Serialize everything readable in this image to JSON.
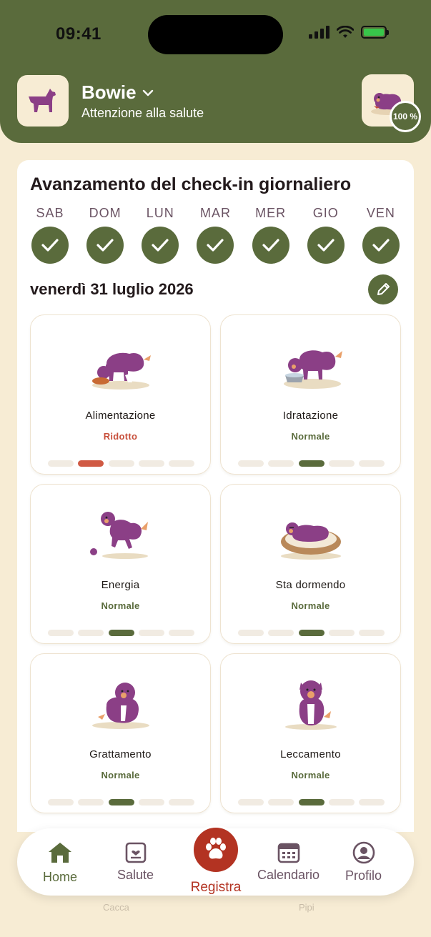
{
  "status": {
    "time": "09:41"
  },
  "header": {
    "pet_name": "Bowie",
    "subtitle": "Attenzione alla salute",
    "completion": "100 %"
  },
  "checkin": {
    "title": "Avanzamento del check-in giornaliero",
    "days": [
      "SAB",
      "DOM",
      "LUN",
      "MAR",
      "MER",
      "GIO",
      "VEN"
    ],
    "date": "venerdì 31 luglio 2026"
  },
  "tiles": [
    {
      "name": "Alimentazione",
      "status": "Ridotto",
      "level": 2,
      "tone": "low"
    },
    {
      "name": "Idratazione",
      "status": "Normale",
      "level": 3,
      "tone": "ok"
    },
    {
      "name": "Energia",
      "status": "Normale",
      "level": 3,
      "tone": "ok"
    },
    {
      "name": "Sta dormendo",
      "status": "Normale",
      "level": 3,
      "tone": "ok"
    },
    {
      "name": "Grattamento",
      "status": "Normale",
      "level": 3,
      "tone": "ok"
    },
    {
      "name": "Leccamento",
      "status": "Normale",
      "level": 3,
      "tone": "ok"
    }
  ],
  "partial_below": {
    "left": "Cacca",
    "right": "Pipi"
  },
  "tabbar": {
    "home": "Home",
    "health": "Salute",
    "log": "Registra",
    "calendar": "Calendario",
    "profile": "Profilo"
  },
  "colors": {
    "brand_green": "#5a6b3c",
    "background": "#f7ecd4",
    "alert": "#c8503c",
    "register": "#b33322",
    "dog_purple": "#8b3f86"
  }
}
